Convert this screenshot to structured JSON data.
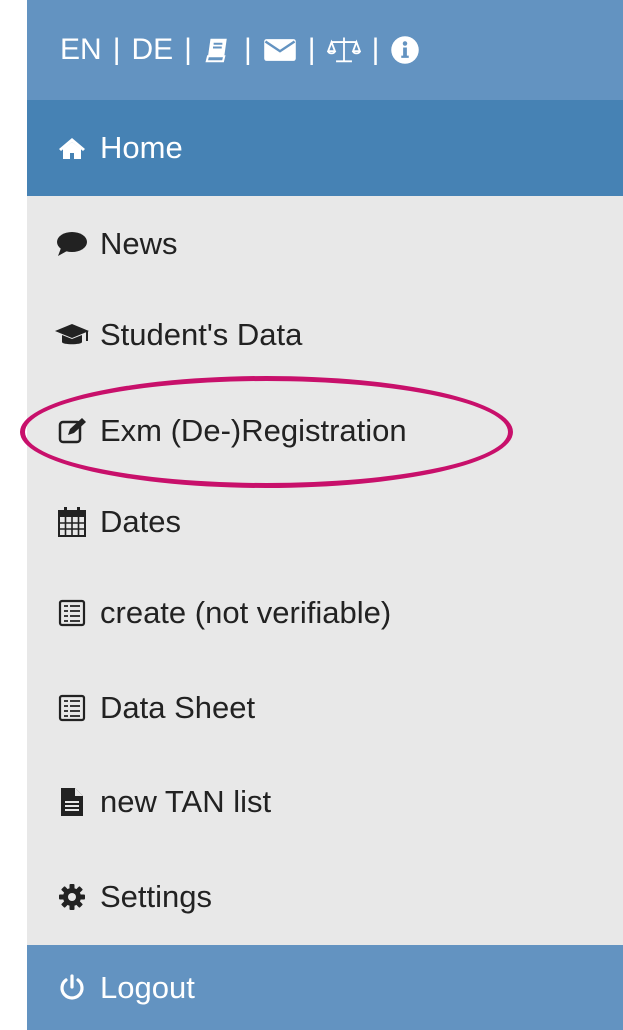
{
  "topbar": {
    "lang_en": "EN",
    "lang_de": "DE",
    "sep": "|",
    "icons": [
      "book-icon",
      "envelope-icon",
      "balance-scale-icon",
      "info-icon"
    ]
  },
  "nav": {
    "home": "Home",
    "news": "News",
    "students_data": "Student's Data",
    "exam_registration": "Exm (De-)Registration",
    "dates": "Dates",
    "create": "create (not verifiable)",
    "data_sheet": "Data Sheet",
    "new_tan_list": "new TAN list",
    "settings": "Settings",
    "logout": "Logout"
  },
  "colors": {
    "topbar": "#6393c1",
    "active": "#4682b4",
    "sidebar_bg": "#e8e8e8",
    "highlight": "#c8106b"
  }
}
